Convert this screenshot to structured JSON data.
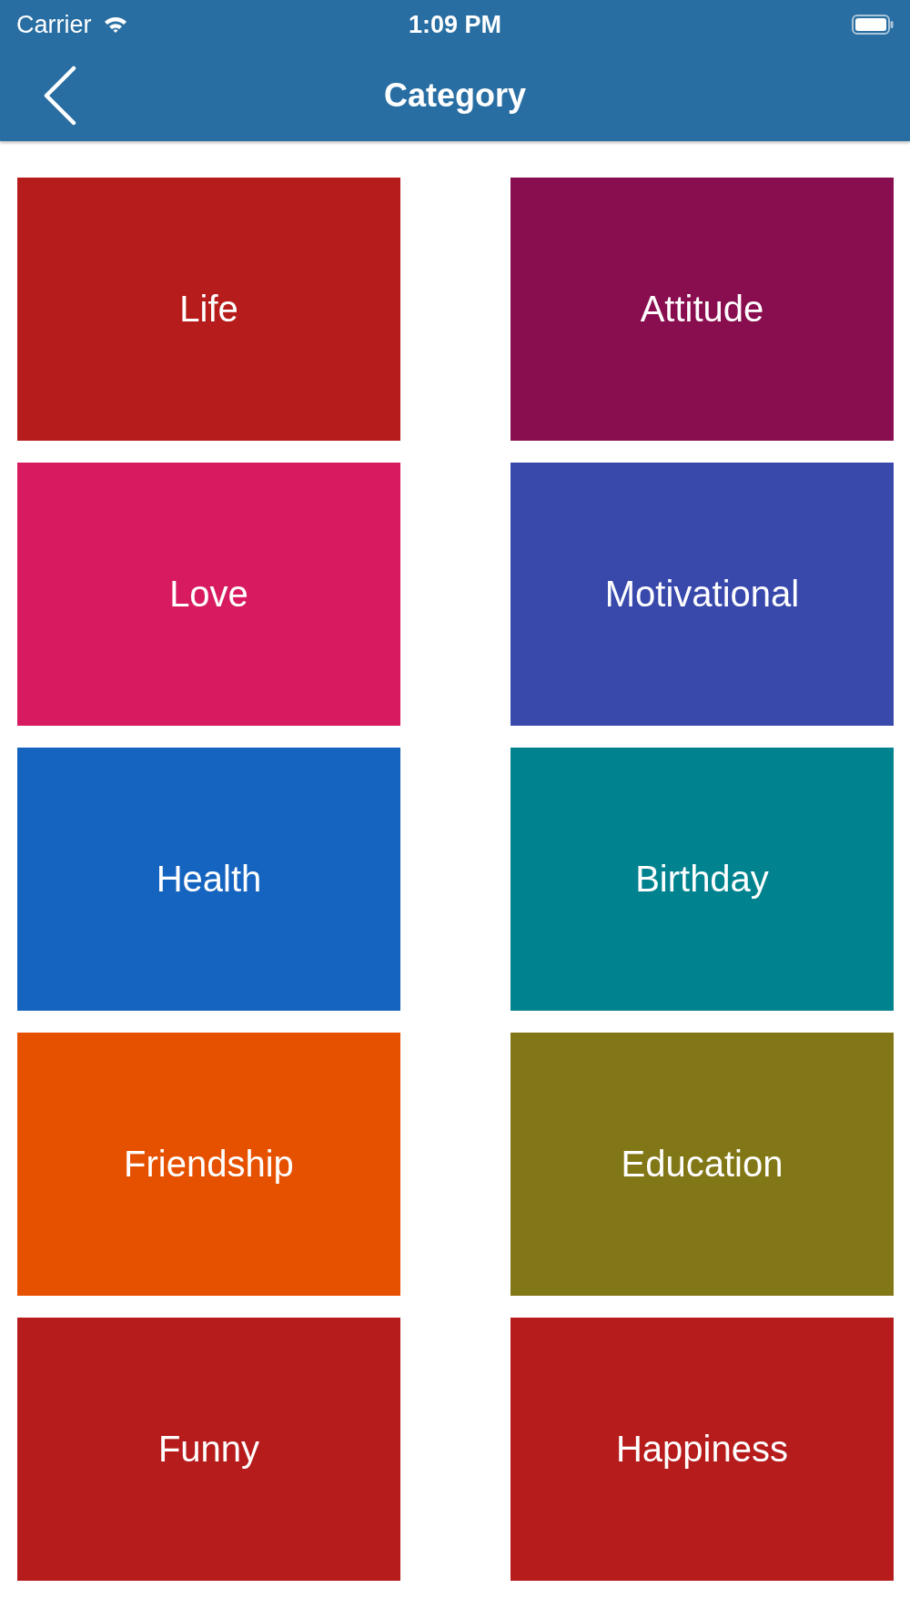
{
  "status_bar": {
    "carrier": "Carrier",
    "time": "1:09 PM"
  },
  "nav_bar": {
    "title": "Category"
  },
  "categories": [
    {
      "label": "Life",
      "color": "#b71c1c"
    },
    {
      "label": "Attitude",
      "color": "#880e4f"
    },
    {
      "label": "Love",
      "color": "#d81b60"
    },
    {
      "label": "Motivational",
      "color": "#3949ab"
    },
    {
      "label": "Health",
      "color": "#1565c0"
    },
    {
      "label": "Birthday",
      "color": "#00838f"
    },
    {
      "label": "Friendship",
      "color": "#e65100"
    },
    {
      "label": "Education",
      "color": "#827717"
    },
    {
      "label": "Funny",
      "color": "#b71c1c"
    },
    {
      "label": "Happiness",
      "color": "#b71c1c"
    }
  ]
}
